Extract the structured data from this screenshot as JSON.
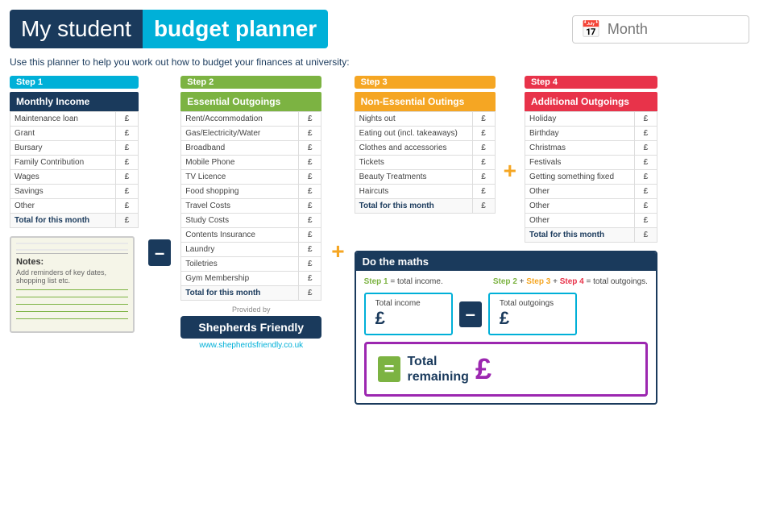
{
  "header": {
    "title_my": "My student",
    "title_budget": "budget planner",
    "month_placeholder": "Month"
  },
  "subtitle": "Use this planner to help you work out how to budget your finances at university:",
  "step1": {
    "badge": "Step 1",
    "header": "Monthly Income",
    "rows": [
      {
        "label": "Maintenance loan",
        "value": "£"
      },
      {
        "label": "Grant",
        "value": "£"
      },
      {
        "label": "Bursary",
        "value": "£"
      },
      {
        "label": "Family Contribution",
        "value": "£"
      },
      {
        "label": "Wages",
        "value": "£"
      },
      {
        "label": "Savings",
        "value": "£"
      },
      {
        "label": "Other",
        "value": "£"
      },
      {
        "label": "Total for this month",
        "value": "£"
      }
    ]
  },
  "step2": {
    "badge": "Step 2",
    "header": "Essential Outgoings",
    "rows": [
      {
        "label": "Rent/Accommodation",
        "value": "£"
      },
      {
        "label": "Gas/Electricity/Water",
        "value": "£"
      },
      {
        "label": "Broadband",
        "value": "£"
      },
      {
        "label": "Mobile Phone",
        "value": "£"
      },
      {
        "label": "TV Licence",
        "value": "£"
      },
      {
        "label": "Food shopping",
        "value": "£"
      },
      {
        "label": "Travel Costs",
        "value": "£"
      },
      {
        "label": "Study Costs",
        "value": "£"
      },
      {
        "label": "Contents Insurance",
        "value": "£"
      },
      {
        "label": "Laundry",
        "value": "£"
      },
      {
        "label": "Toiletries",
        "value": "£"
      },
      {
        "label": "Gym Membership",
        "value": "£"
      },
      {
        "label": "Total for this month",
        "value": "£"
      }
    ]
  },
  "step3": {
    "badge": "Step 3",
    "header": "Non-Essential Outings",
    "rows": [
      {
        "label": "Nights out",
        "value": "£"
      },
      {
        "label": "Eating out (incl. takeaways)",
        "value": "£"
      },
      {
        "label": "Clothes and accessories",
        "value": "£"
      },
      {
        "label": "Tickets",
        "value": "£"
      },
      {
        "label": "Beauty Treatments",
        "value": "£"
      },
      {
        "label": "Haircuts",
        "value": "£"
      },
      {
        "label": "Total for this month",
        "value": "£"
      }
    ]
  },
  "step4": {
    "badge": "Step 4",
    "header": "Additional Outgoings",
    "rows": [
      {
        "label": "Holiday",
        "value": "£"
      },
      {
        "label": "Birthday",
        "value": "£"
      },
      {
        "label": "Christmas",
        "value": "£"
      },
      {
        "label": "Festivals",
        "value": "£"
      },
      {
        "label": "Getting something fixed",
        "value": "£"
      },
      {
        "label": "Other",
        "value": "£"
      },
      {
        "label": "Other",
        "value": "£"
      },
      {
        "label": "Other",
        "value": "£"
      },
      {
        "label": "Total for this month",
        "value": "£"
      }
    ]
  },
  "notes": {
    "label": "Notes:",
    "hint": "Add reminders of key dates, shopping list etc."
  },
  "maths": {
    "header": "Do the maths",
    "desc1": "Step 1 = total income.",
    "desc2": "Step 2 + Step 3 + Step 4 = total outgoings.",
    "total_income_label": "Total income",
    "total_income_symbol": "£",
    "total_outgoings_label": "Total outgoings",
    "total_outgoings_symbol": "£",
    "total_remaining_label1": "Total",
    "total_remaining_label2": "remaining",
    "total_remaining_symbol": "£"
  },
  "provided_by": {
    "text": "Provided by",
    "brand": "Shepherds Friendly",
    "url": "www.shepherdsfriendly.co.uk"
  },
  "operators": {
    "minus": "–",
    "plus": "+",
    "equals": "="
  }
}
